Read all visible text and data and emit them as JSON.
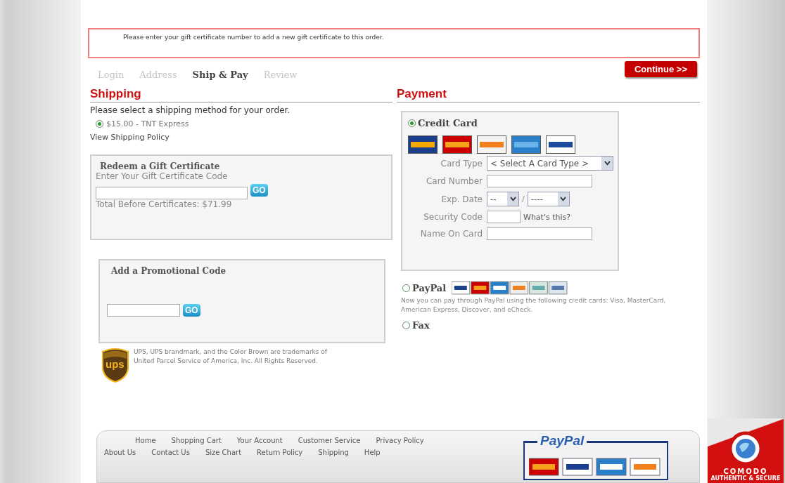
{
  "notice": "Please enter your gift certificate number to add a new gift certificate to this order.",
  "steps": [
    {
      "label": "Login",
      "selected": false
    },
    {
      "label": "Address",
      "selected": false
    },
    {
      "label": "Ship & Pay",
      "selected": true
    },
    {
      "label": "Review",
      "selected": false
    }
  ],
  "continue_button": "Continue >>",
  "shipping": {
    "heading": "Shipping",
    "prompt": "Please select a shipping method for your order.",
    "methods": [
      {
        "label": "$15.00 - TNT Express",
        "selected": true
      }
    ],
    "policy_link": "View Shipping Policy"
  },
  "gift_certificate": {
    "title": "Redeem a Gift Certificate",
    "label": "Enter Your Gift Certificate Code",
    "go_button": "GO",
    "total": "Total Before Certificates: $71.99"
  },
  "promo": {
    "title": "Add a Promotional Code",
    "go_button": "GO"
  },
  "ups_notice": {
    "logo": "ups",
    "text": "UPS, UPS brandmark, and the Color Brown are trademarks of United Parcel Service of America, Inc. All Rights Reserved."
  },
  "payment": {
    "heading": "Payment",
    "options": [
      {
        "kind": "card",
        "label": "Credit Card",
        "selected": true
      },
      {
        "kind": "paypal",
        "label": "PayPal",
        "selected": false,
        "note": "Now you can pay through PayPal using the following credit cards: Visa, MasterCard, American Express, Discover, and eCheck."
      },
      {
        "kind": "plain",
        "label": "Fax",
        "selected": false
      }
    ],
    "card_form": {
      "card_type_label": "Card Type",
      "card_type_value": "< Select A Card Type >",
      "card_number_label": "Card Number",
      "exp_label": "Exp. Date",
      "exp_month": "--",
      "separator": "/",
      "exp_year": "----",
      "security_label": "Security Code",
      "whats_this": "What's this?",
      "name_label": "Name On Card"
    }
  },
  "footer": {
    "links": [
      [
        "Home",
        "Shopping Cart",
        "Your Account",
        "Customer Service",
        "Privacy Policy"
      ],
      [
        "About Us",
        "Contact Us",
        "Size Chart",
        "Return Policy",
        "Shipping",
        "Help"
      ]
    ],
    "paypal_logo": "PayPal"
  },
  "security_badge": {
    "brand": "COMODO",
    "tagline": "AUTHENTIC & SECURE"
  }
}
